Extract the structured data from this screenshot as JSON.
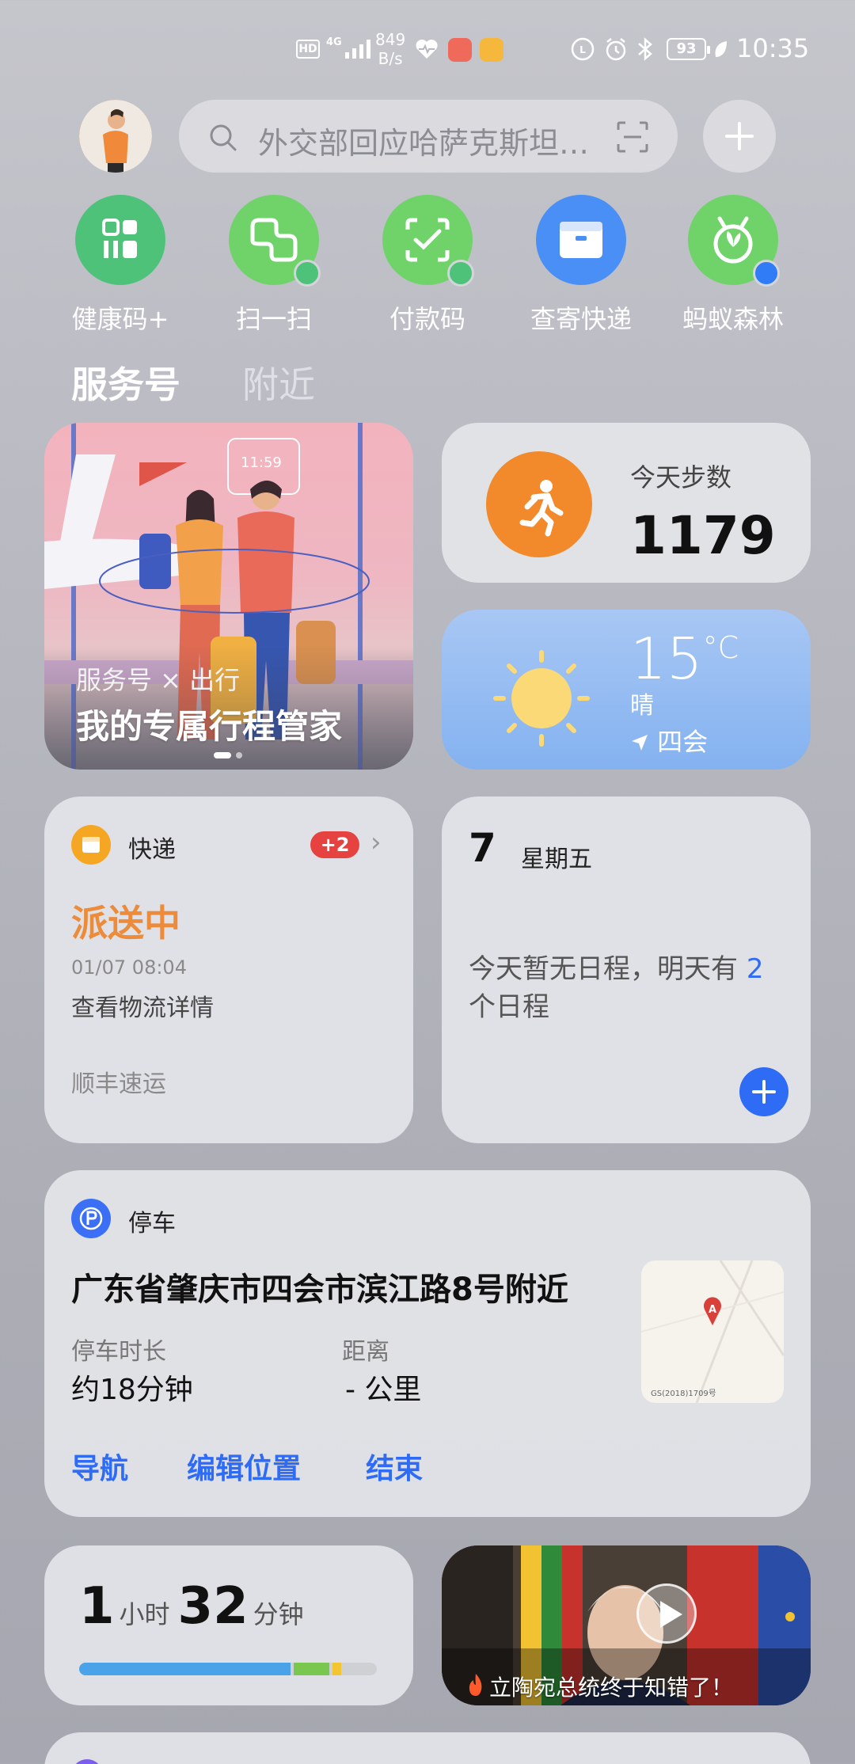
{
  "status_bar": {
    "hd": "HD",
    "network": "4G",
    "speed_value": "849",
    "speed_unit": "B/s",
    "battery": "93",
    "time": "10:35"
  },
  "top_bar": {
    "search_placeholder": "外交部回应哈萨克斯坦局势"
  },
  "shortcuts": [
    {
      "label": "健康码+",
      "color": "#4fc27a",
      "icon": "health-code-icon"
    },
    {
      "label": "扫一扫",
      "color": "#6fd36a",
      "icon": "scan-icon",
      "badge": "wechat"
    },
    {
      "label": "付款码",
      "color": "#6fd36a",
      "icon": "payment-code-icon",
      "badge": "wechat"
    },
    {
      "label": "查寄快递",
      "color": "#4a8ff5",
      "icon": "package-icon"
    },
    {
      "label": "蚂蚁森林",
      "color": "#6fd36a",
      "icon": "ant-forest-icon",
      "badge": "alipay"
    }
  ],
  "tabs": {
    "active": "服务号",
    "inactive": "附近"
  },
  "travel_card": {
    "subtitle": "服务号 × 出行",
    "title": "我的专属行程管家",
    "illustration_clock": "11:59"
  },
  "steps_card": {
    "label": "今天步数",
    "value": "1179"
  },
  "weather_card": {
    "temperature": "15",
    "unit": "°C",
    "condition": "晴",
    "location": "四会"
  },
  "express_card": {
    "title": "快递",
    "badge": "+2",
    "status": "派送中",
    "time": "01/07 08:04",
    "detail": "查看物流详情",
    "carrier": "顺丰速运"
  },
  "calendar_card": {
    "day": "7",
    "weekday": "星期五",
    "text_prefix": "今天暂无日程，明天有 ",
    "count": "2",
    "text_suffix": " 个日程"
  },
  "parking_card": {
    "title": "停车",
    "address": "广东省肇庆市四会市滨江路8号附近",
    "duration_label": "停车时长",
    "duration_value": "约18分钟",
    "distance_label": "距离",
    "distance_value": "- 公里",
    "actions": [
      "导航",
      "编辑位置",
      "结束"
    ],
    "map_marker": "A",
    "map_note": "GS(2018)1709号"
  },
  "usage_card": {
    "hours": "1",
    "hours_unit": "小时",
    "minutes": "32",
    "minutes_unit": "分钟",
    "segments": [
      {
        "fraction": 0.72,
        "color": "#4aa3e8"
      },
      {
        "fraction": 0.13,
        "color": "#7ac74f"
      },
      {
        "fraction": 0.04,
        "color": "#f3c531"
      }
    ]
  },
  "video_card": {
    "caption": "立陶宛总统终于知错了！"
  }
}
